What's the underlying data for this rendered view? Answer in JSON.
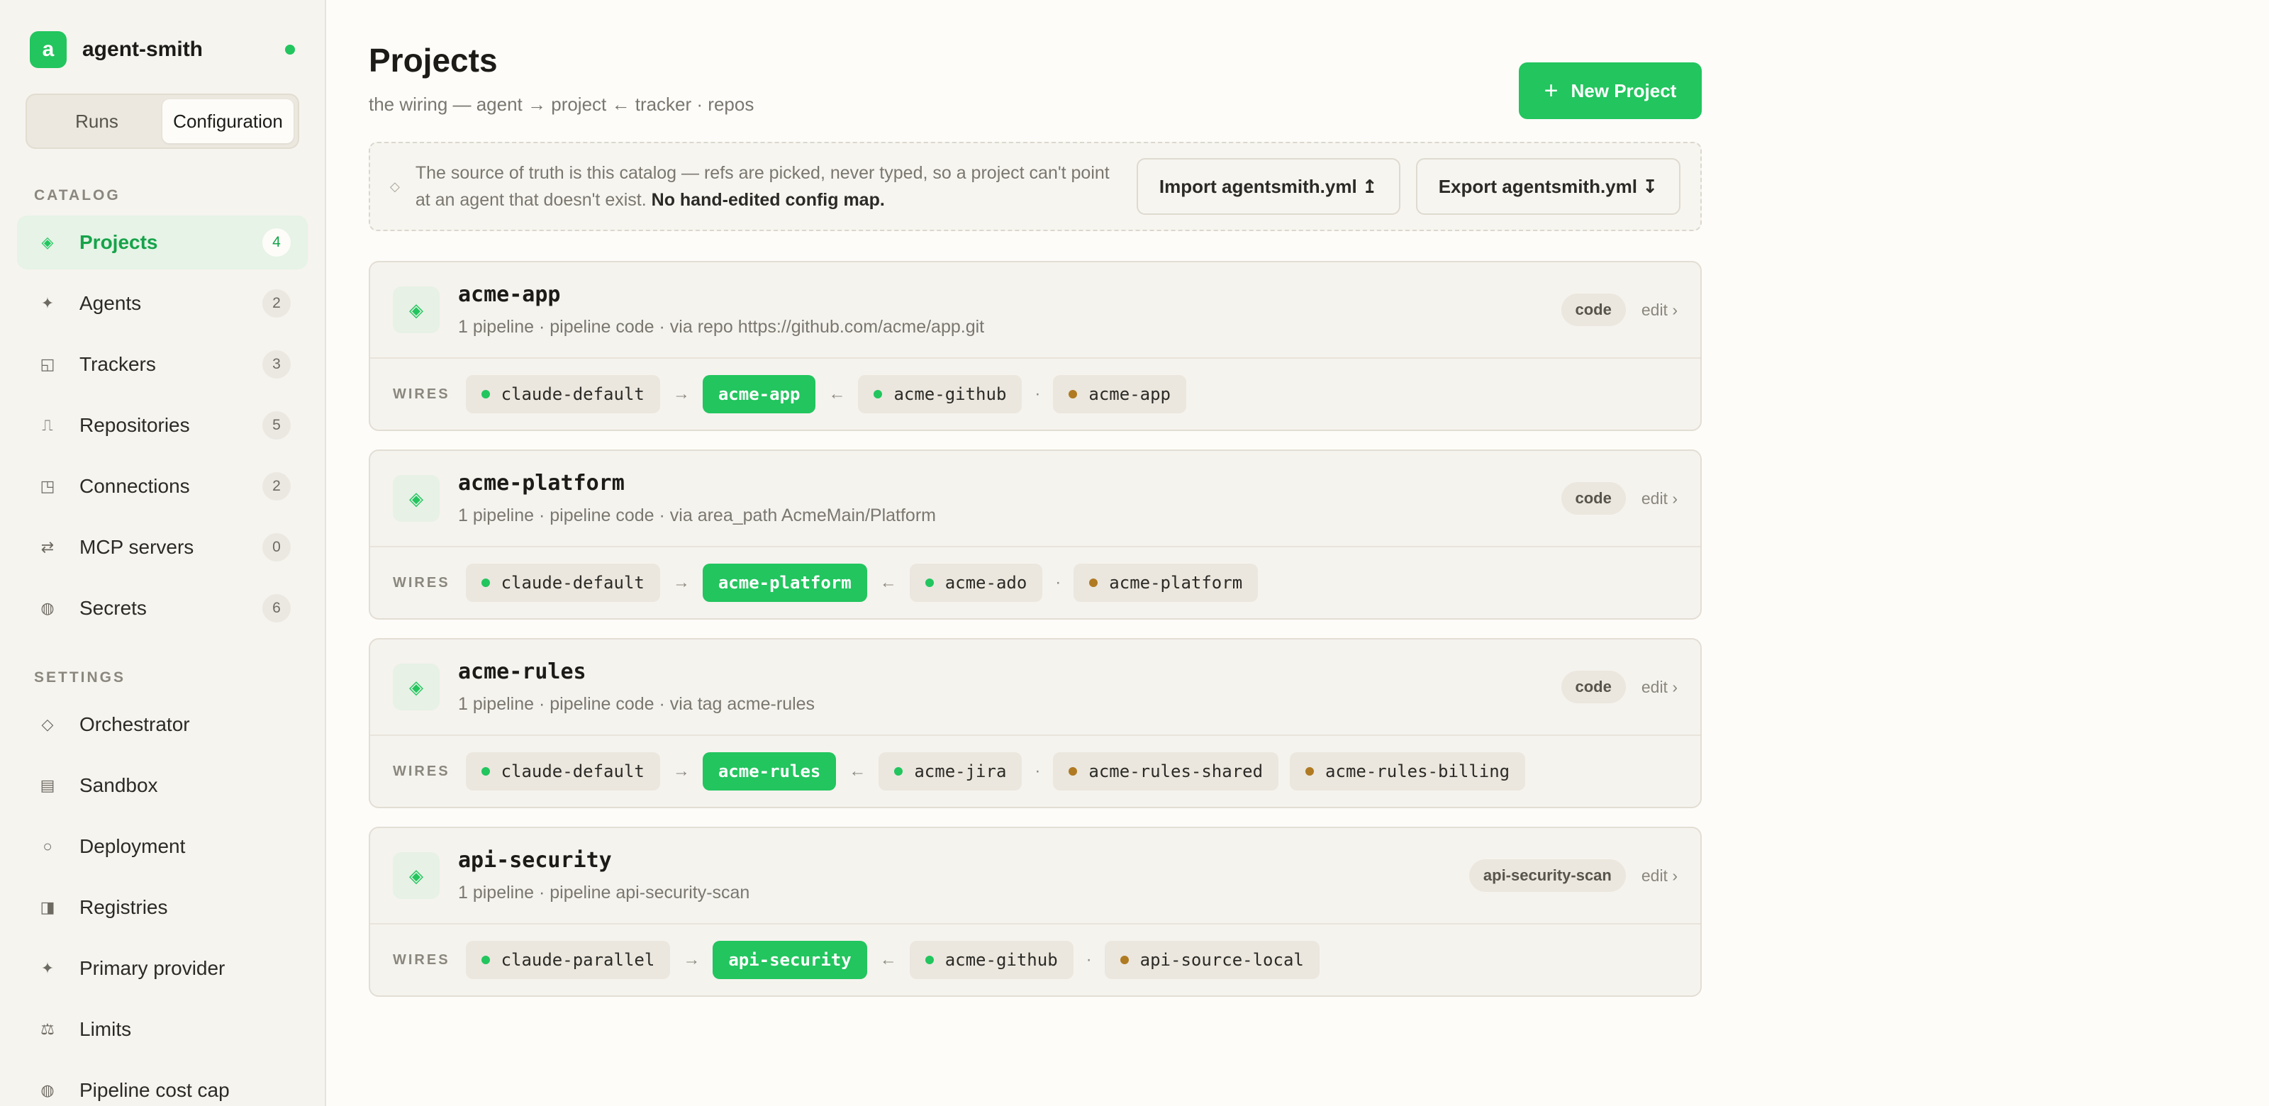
{
  "brand": {
    "logo_letter": "a",
    "name": "agent-smith"
  },
  "tabs": {
    "runs": "Runs",
    "configuration": "Configuration"
  },
  "sidebar": {
    "catalog_label": "CATALOG",
    "settings_label": "SETTINGS",
    "catalog": [
      {
        "label": "Projects",
        "count": "4",
        "icon": "◈"
      },
      {
        "label": "Agents",
        "count": "2",
        "icon": "✦"
      },
      {
        "label": "Trackers",
        "count": "3",
        "icon": "◱"
      },
      {
        "label": "Repositories",
        "count": "5",
        "icon": "⎍"
      },
      {
        "label": "Connections",
        "count": "2",
        "icon": "◳"
      },
      {
        "label": "MCP servers",
        "count": "0",
        "icon": "⇄"
      },
      {
        "label": "Secrets",
        "count": "6",
        "icon": "◍"
      }
    ],
    "settings": [
      {
        "label": "Orchestrator",
        "icon": "◇"
      },
      {
        "label": "Sandbox",
        "icon": "▤"
      },
      {
        "label": "Deployment",
        "icon": "○"
      },
      {
        "label": "Registries",
        "icon": "◨"
      },
      {
        "label": "Primary provider",
        "icon": "✦"
      },
      {
        "label": "Limits",
        "icon": "⚖"
      },
      {
        "label": "Pipeline cost cap",
        "icon": "◍"
      }
    ]
  },
  "header": {
    "title": "Projects",
    "subtitle": "the wiring — agent → project ← tracker · repos",
    "new_button": "New Project"
  },
  "notice": {
    "text": "The source of truth is this catalog — refs are picked, never typed, so a project can't point at an agent that doesn't exist.",
    "bold": "No hand-edited config map.",
    "import_button": "Import agentsmith.yml ↥",
    "export_button": "Export agentsmith.yml ↧"
  },
  "wires_label": "WIRES",
  "edit_label": "edit ›",
  "projects": [
    {
      "name": "acme-app",
      "desc": "1 pipeline · pipeline code · via repo https://github.com/acme/app.git",
      "tag": "code",
      "agent": "claude-default",
      "project": "acme-app",
      "tracker": "acme-github",
      "repos": [
        "acme-app"
      ]
    },
    {
      "name": "acme-platform",
      "desc": "1 pipeline · pipeline code · via area_path AcmeMain/Platform",
      "tag": "code",
      "agent": "claude-default",
      "project": "acme-platform",
      "tracker": "acme-ado",
      "repos": [
        "acme-platform"
      ]
    },
    {
      "name": "acme-rules",
      "desc": "1 pipeline · pipeline code · via tag acme-rules",
      "tag": "code",
      "agent": "claude-default",
      "project": "acme-rules",
      "tracker": "acme-jira",
      "repos": [
        "acme-rules-shared",
        "acme-rules-billing"
      ]
    },
    {
      "name": "api-security",
      "desc": "1 pipeline · pipeline api-security-scan",
      "tag": "api-security-scan",
      "agent": "claude-parallel",
      "project": "api-security",
      "tracker": "acme-github",
      "repos": [
        "api-source-local"
      ]
    }
  ],
  "colors": {
    "accent": "#22c55e",
    "repo_dot": "#b07a22"
  }
}
